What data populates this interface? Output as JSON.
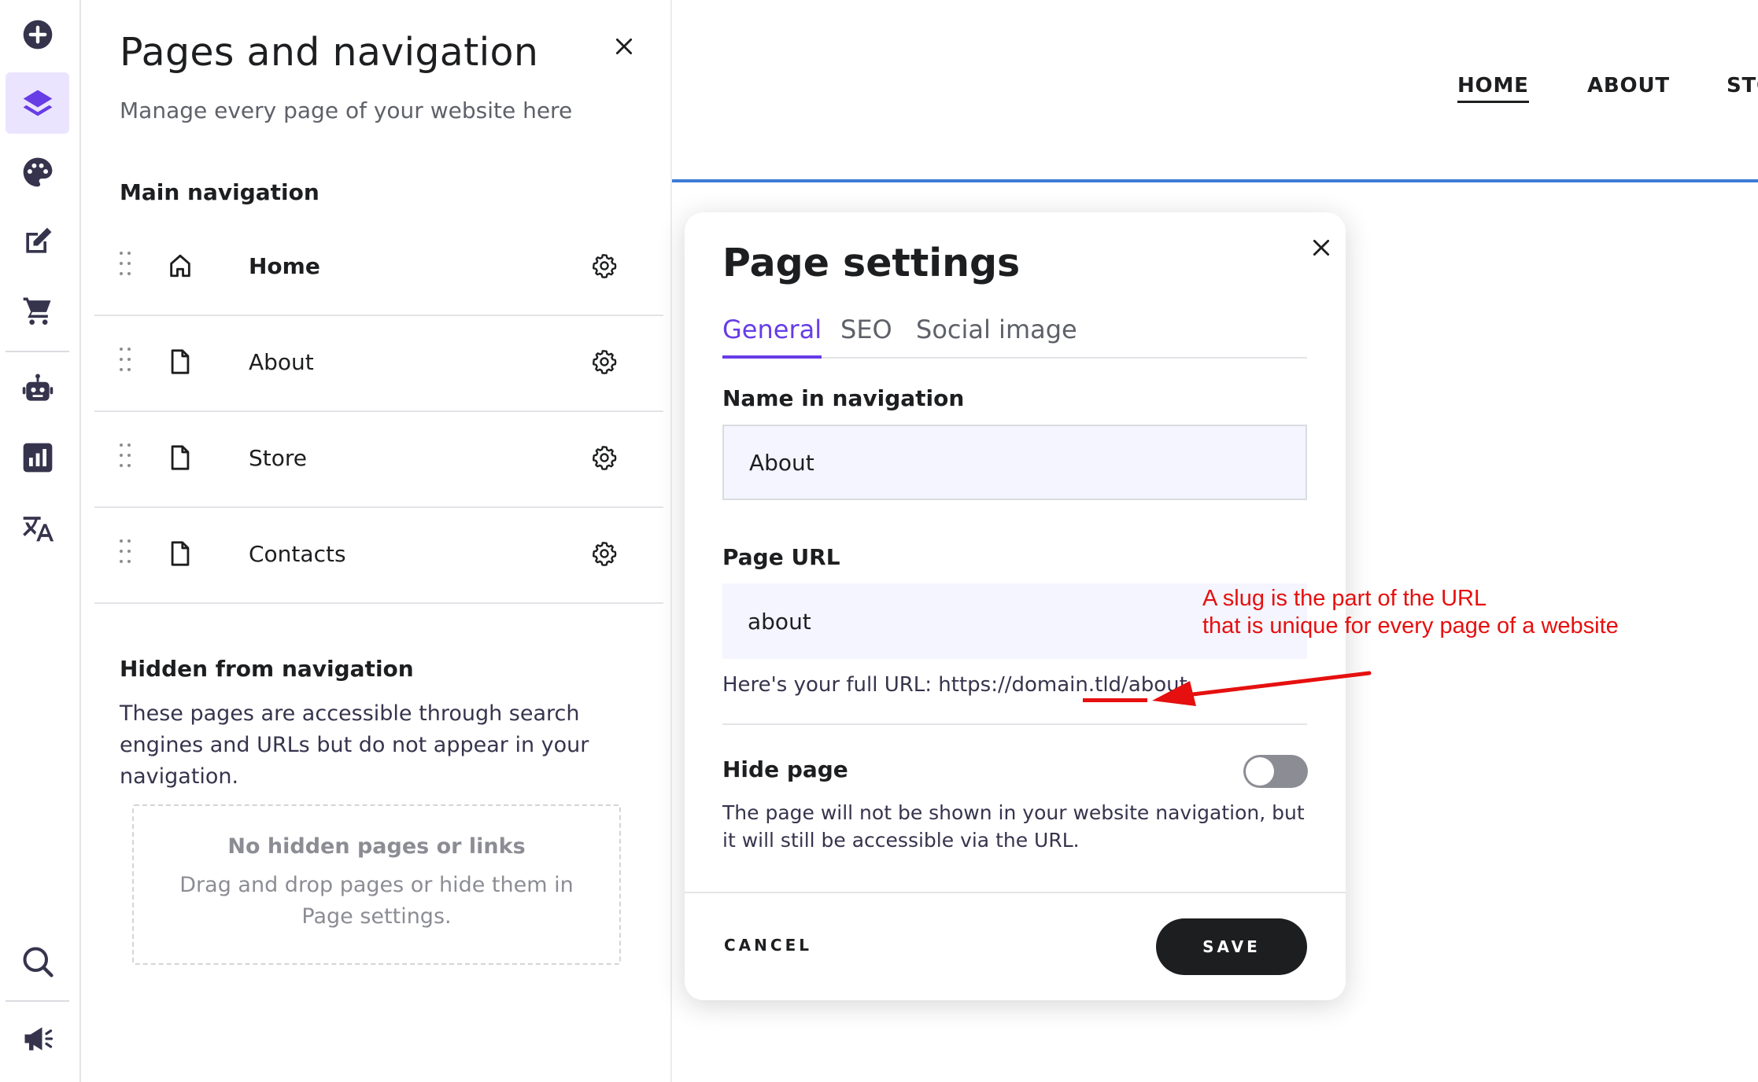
{
  "rail": {
    "items": [
      {
        "icon": "add-circle-icon",
        "active": false
      },
      {
        "icon": "layers-icon",
        "active": true
      },
      {
        "icon": "palette-icon",
        "active": false
      },
      {
        "icon": "edit-icon",
        "active": false
      },
      {
        "icon": "cart-icon",
        "active": false
      },
      {
        "icon": "robot-icon",
        "active": false
      },
      {
        "icon": "analytics-icon",
        "active": false
      },
      {
        "icon": "translate-icon",
        "active": false
      },
      {
        "icon": "search-icon",
        "active": false
      },
      {
        "icon": "megaphone-icon",
        "active": false
      }
    ],
    "accent_color": "#673de6",
    "icon_color": "#36344d"
  },
  "panel": {
    "title": "Pages and navigation",
    "subtitle": "Manage every page of your website here",
    "main_nav_heading": "Main navigation",
    "pages": [
      {
        "label": "Home",
        "icon": "home-icon"
      },
      {
        "label": "About",
        "icon": "page-icon"
      },
      {
        "label": "Store",
        "icon": "page-icon"
      },
      {
        "label": "Contacts",
        "icon": "page-icon"
      }
    ],
    "hidden_heading": "Hidden from navigation",
    "hidden_description": "These pages are accessible through search engines and URLs but do not appear in your navigation.",
    "empty_title": "No hidden pages or links",
    "empty_text": "Drag and drop pages or hide them in Page settings."
  },
  "site": {
    "nav": [
      "HOME",
      "ABOUT",
      "STO"
    ],
    "active": "HOME",
    "line_color": "#3d7cd6"
  },
  "modal": {
    "title": "Page settings",
    "tabs": [
      "General",
      "SEO",
      "Social image"
    ],
    "active_tab": "General",
    "name_label": "Name in navigation",
    "name_value": "About",
    "url_label": "Page URL",
    "url_value": "about",
    "full_url_prefix": "Here's your full URL: https://domain.tld/",
    "full_url_slug": "about",
    "hide_label": "Hide page",
    "hide_enabled": false,
    "hide_description": "The page will not be shown in your website navigation, but it will still be accessible via the URL.",
    "cancel_label": "CANCEL",
    "save_label": "SAVE"
  },
  "annotation": {
    "line1": "A slug is the part of the URL",
    "line2": "that is unique for every page of a website",
    "color": "#e5100f"
  }
}
